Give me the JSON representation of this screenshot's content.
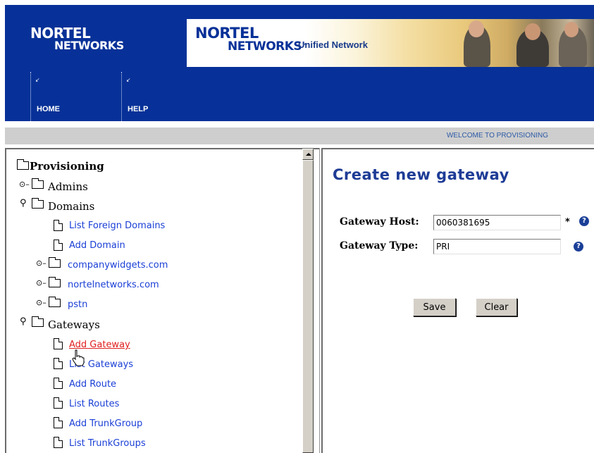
{
  "header": {
    "logo": {
      "line1": "NORTEL",
      "line2": "NETWORKS"
    },
    "banner": {
      "logo": {
        "line1": "NORTEL",
        "line2": "NETWORKS"
      },
      "trademark": "™",
      "tagline": "Unified Network"
    },
    "nav": [
      {
        "label": "HOME",
        "icon": "arrow-icon"
      },
      {
        "label": "HELP",
        "icon": "arrow-icon"
      }
    ]
  },
  "welcome": {
    "text": "WELCOME TO PROVISIONING"
  },
  "tree": {
    "root": "Provisioning",
    "admins": "Admins",
    "domains": "Domains",
    "domain_items": [
      "List Foreign Domains",
      "Add Domain"
    ],
    "domain_folders": [
      "companywidgets.com",
      "nortelnetworks.com",
      "pstn"
    ],
    "gateways": "Gateways",
    "gateway_items": [
      "Add Gateway",
      "List Gateways",
      "Add Route",
      "List Routes",
      "Add TrunkGroup",
      "List TrunkGroups"
    ],
    "active_item": "Add Gateway"
  },
  "form": {
    "title": "Create new gateway",
    "host_label": "Gateway Host:",
    "host_value": "0060381695",
    "required_mark": "*",
    "type_label": "Gateway Type:",
    "type_value": "PRI",
    "help_glyph": "?",
    "save_label": "Save",
    "clear_label": "Clear"
  },
  "colors": {
    "header_blue": "#073198",
    "link": "#1a3fd6",
    "active_link": "#e02020",
    "title": "#1e3c96"
  }
}
